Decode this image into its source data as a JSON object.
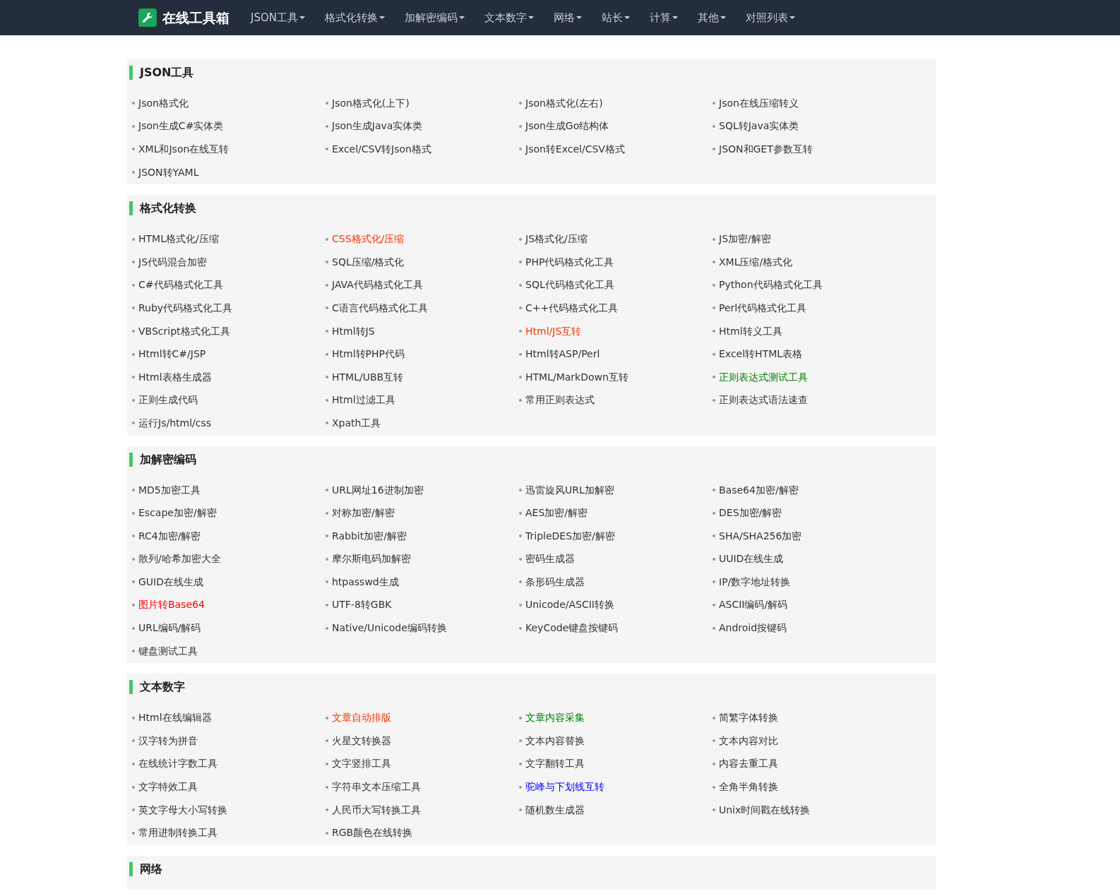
{
  "navbar": {
    "brand": "在线工具箱",
    "menu": [
      "JSON工具",
      "格式化转换",
      "加解密编码",
      "文本数字",
      "网络",
      "站长",
      "计算",
      "其他",
      "对照列表"
    ]
  },
  "sections": [
    {
      "title": "JSON工具",
      "links": [
        {
          "label": "Json格式化"
        },
        {
          "label": "Json格式化(上下)"
        },
        {
          "label": "Json格式化(左右)"
        },
        {
          "label": "Json在线压缩转义"
        },
        {
          "label": "Json生成C#实体类"
        },
        {
          "label": "Json生成Java实体类"
        },
        {
          "label": "Json生成Go结构体"
        },
        {
          "label": "SQL转Java实体类"
        },
        {
          "label": "XML和Json在线互转"
        },
        {
          "label": "Excel/CSV转Json格式"
        },
        {
          "label": "Json转Excel/CSV格式"
        },
        {
          "label": "JSON和GET参数互转"
        },
        {
          "label": "JSON转YAML"
        }
      ]
    },
    {
      "title": "格式化转换",
      "links": [
        {
          "label": "HTML格式化/压缩"
        },
        {
          "label": "CSS格式化/压缩",
          "color": "#ff3300"
        },
        {
          "label": "JS格式化/压缩"
        },
        {
          "label": "JS加密/解密"
        },
        {
          "label": "JS代码混合加密"
        },
        {
          "label": "SQL压缩/格式化"
        },
        {
          "label": "PHP代码格式化工具"
        },
        {
          "label": "XML压缩/格式化"
        },
        {
          "label": "C#代码格式化工具"
        },
        {
          "label": "JAVA代码格式化工具"
        },
        {
          "label": "SQL代码格式化工具"
        },
        {
          "label": "Python代码格式化工具"
        },
        {
          "label": "Ruby代码格式化工具"
        },
        {
          "label": "C语言代码格式化工具"
        },
        {
          "label": "C++代码格式化工具"
        },
        {
          "label": "Perl代码格式化工具"
        },
        {
          "label": "VBScript格式化工具"
        },
        {
          "label": "Html转JS"
        },
        {
          "label": "Html/JS互转",
          "color": "#ff3300"
        },
        {
          "label": "Html转义工具"
        },
        {
          "label": "Html转C#/JSP"
        },
        {
          "label": "Html转PHP代码"
        },
        {
          "label": "Html转ASP/Perl"
        },
        {
          "label": "Excel转HTML表格"
        },
        {
          "label": "Html表格生成器"
        },
        {
          "label": "HTML/UBB互转"
        },
        {
          "label": "HTML/MarkDown互转"
        },
        {
          "label": "正则表达式测试工具",
          "color": "#008000"
        },
        {
          "label": "正则生成代码"
        },
        {
          "label": "Html过滤工具"
        },
        {
          "label": "常用正则表达式"
        },
        {
          "label": "正则表达式语法速查"
        },
        {
          "label": "运行Js/html/css"
        },
        {
          "label": "Xpath工具"
        }
      ]
    },
    {
      "title": "加解密编码",
      "links": [
        {
          "label": "MD5加密工具"
        },
        {
          "label": "URL网址16进制加密"
        },
        {
          "label": "迅雷旋风URL加解密"
        },
        {
          "label": "Base64加密/解密"
        },
        {
          "label": "Escape加密/解密"
        },
        {
          "label": "对称加密/解密"
        },
        {
          "label": "AES加密/解密"
        },
        {
          "label": "DES加密/解密"
        },
        {
          "label": "RC4加密/解密"
        },
        {
          "label": "Rabbit加密/解密"
        },
        {
          "label": "TripleDES加密/解密"
        },
        {
          "label": "SHA/SHA256加密"
        },
        {
          "label": "散列/哈希加密大全"
        },
        {
          "label": "摩尔斯电码加解密"
        },
        {
          "label": "密码生成器"
        },
        {
          "label": "UUID在线生成"
        },
        {
          "label": "GUID在线生成"
        },
        {
          "label": "htpasswd生成"
        },
        {
          "label": "条形码生成器"
        },
        {
          "label": "IP/数字地址转换"
        },
        {
          "label": "图片转Base64",
          "color": "#ff0000"
        },
        {
          "label": "UTF-8转GBK"
        },
        {
          "label": "Unicode/ASCII转换"
        },
        {
          "label": "ASCII编码/解码"
        },
        {
          "label": "URL编码/解码"
        },
        {
          "label": "Native/Unicode编码转换"
        },
        {
          "label": "KeyCode键盘按键码"
        },
        {
          "label": "Android按键码"
        },
        {
          "label": "键盘测试工具"
        }
      ]
    },
    {
      "title": "文本数字",
      "links": [
        {
          "label": "Html在线编辑器"
        },
        {
          "label": "文章自动排版",
          "color": "#ff3300"
        },
        {
          "label": "文章内容采集",
          "color": "#008000"
        },
        {
          "label": "简繁字体转换"
        },
        {
          "label": "汉字转为拼音"
        },
        {
          "label": "火星文转换器"
        },
        {
          "label": "文本内容替换"
        },
        {
          "label": "文本内容对比"
        },
        {
          "label": "在线统计字数工具"
        },
        {
          "label": "文字竖排工具"
        },
        {
          "label": "文字翻转工具"
        },
        {
          "label": "内容去重工具"
        },
        {
          "label": "文字特效工具"
        },
        {
          "label": "字符串文本压缩工具"
        },
        {
          "label": "驼峰与下划线互转",
          "color": "#0000ff"
        },
        {
          "label": "全角半角转换"
        },
        {
          "label": "英文字母大小写转换"
        },
        {
          "label": "人民币大写转换工具"
        },
        {
          "label": "随机数生成器"
        },
        {
          "label": "Unix时间戳在线转换"
        },
        {
          "label": "常用进制转换工具"
        },
        {
          "label": "RGB颜色在线转换"
        }
      ]
    },
    {
      "title": "网络"
    }
  ]
}
